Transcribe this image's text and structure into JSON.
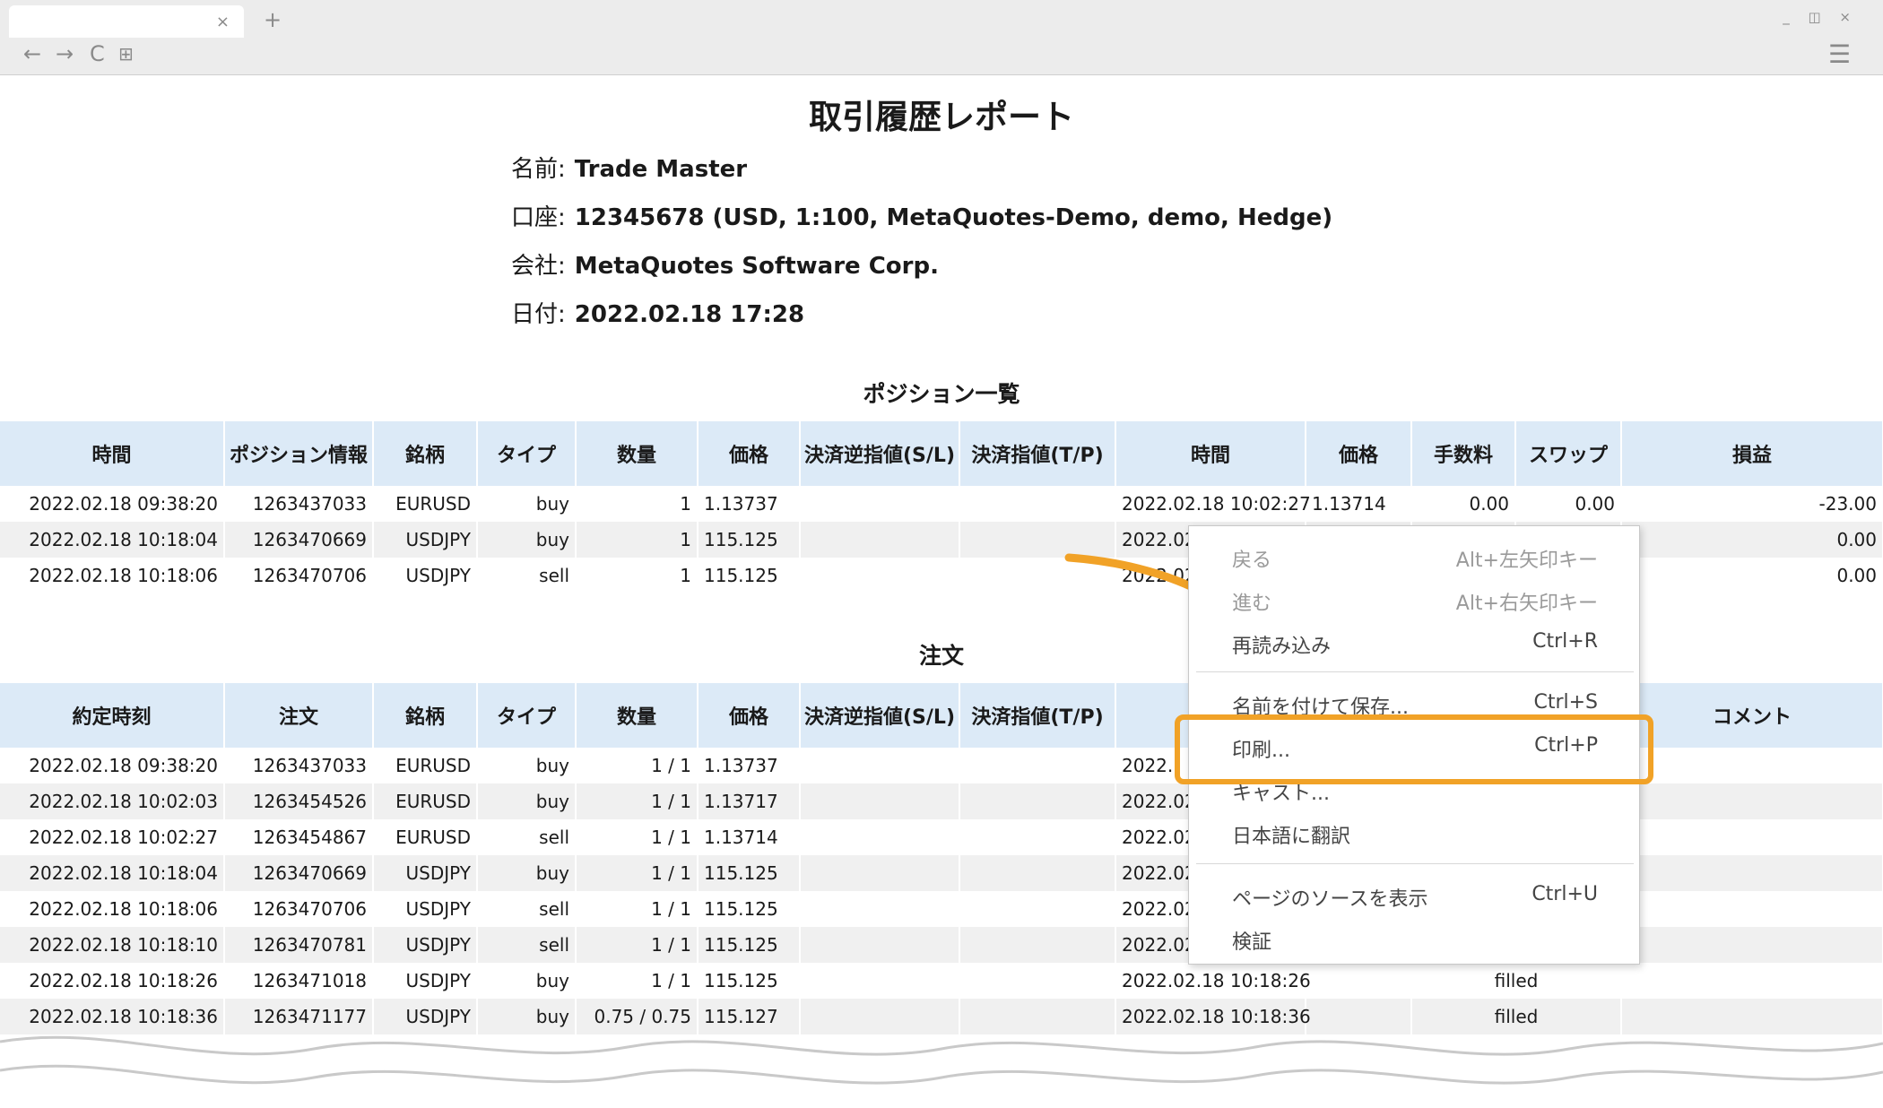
{
  "browser": {
    "tab_close": "×",
    "new_tab": "+",
    "window_controls": "_ ◫ ×",
    "nav": {
      "back": "←",
      "forward": "→",
      "reload": "C",
      "apps": "⊞",
      "menu": "☰"
    }
  },
  "report": {
    "title": "取引履歴レポート",
    "info": [
      {
        "label": "名前:",
        "value": "Trade Master"
      },
      {
        "label": "口座:",
        "value": "12345678 (USD, 1:100, MetaQuotes-Demo, demo, Hedge)"
      },
      {
        "label": "会社:",
        "value": "MetaQuotes Software Corp."
      },
      {
        "label": "日付:",
        "value": "2022.02.18 17:28"
      }
    ]
  },
  "positions": {
    "title": "ポジション一覧",
    "headers": [
      "時間",
      "ポジション情報",
      "銘柄",
      "タイプ",
      "数量",
      "価格",
      "決済逆指値(S/L)",
      "決済指値(T/P)",
      "時間",
      "価格",
      "手数料",
      "スワップ",
      "損益"
    ],
    "rows": [
      [
        "2022.02.18 09:38:20",
        "1263437033",
        "EURUSD",
        "buy",
        "1",
        "1.13737",
        "",
        "",
        "2022.02.18 10:02:27",
        "1.13714",
        "0.00",
        "0.00",
        "-23.00"
      ],
      [
        "2022.02.18 10:18:04",
        "1263470669",
        "USDJPY",
        "buy",
        "1",
        "115.125",
        "",
        "",
        "2022.02",
        "",
        "",
        "",
        "0.00"
      ],
      [
        "2022.02.18 10:18:06",
        "1263470706",
        "USDJPY",
        "sell",
        "1",
        "115.125",
        "",
        "",
        "2022.02",
        "",
        "",
        "",
        "0.00"
      ]
    ]
  },
  "orders": {
    "title": "注文",
    "headers": [
      "約定時刻",
      "注文",
      "銘柄",
      "タイプ",
      "数量",
      "価格",
      "決済逆指値(S/L)",
      "決済指値(T/P)",
      "",
      "",
      "",
      "コメント"
    ],
    "rows": [
      [
        "2022.02.18 09:38:20",
        "1263437033",
        "EURUSD",
        "buy",
        "1 / 1",
        "1.13737",
        "",
        "",
        "2022.",
        "",
        "",
        ""
      ],
      [
        "2022.02.18 10:02:03",
        "1263454526",
        "EURUSD",
        "buy",
        "1 / 1",
        "1.13717",
        "",
        "",
        "2022.02",
        "",
        "",
        ""
      ],
      [
        "2022.02.18 10:02:27",
        "1263454867",
        "EURUSD",
        "sell",
        "1 / 1",
        "1.13714",
        "",
        "",
        "2022.02",
        "",
        "",
        ""
      ],
      [
        "2022.02.18 10:18:04",
        "1263470669",
        "USDJPY",
        "buy",
        "1 / 1",
        "115.125",
        "",
        "",
        "2022.02",
        "",
        "",
        ""
      ],
      [
        "2022.02.18 10:18:06",
        "1263470706",
        "USDJPY",
        "sell",
        "1 / 1",
        "115.125",
        "",
        "",
        "2022.02",
        "",
        "",
        ""
      ],
      [
        "2022.02.18 10:18:10",
        "1263470781",
        "USDJPY",
        "sell",
        "1 / 1",
        "115.125",
        "",
        "",
        "2022.02",
        "",
        "",
        ""
      ],
      [
        "2022.02.18 10:18:26",
        "1263471018",
        "USDJPY",
        "buy",
        "1 / 1",
        "115.125",
        "",
        "",
        "2022.02.18 10:18:26",
        "",
        "filled",
        ""
      ],
      [
        "2022.02.18 10:18:36",
        "1263471177",
        "USDJPY",
        "buy",
        "0.75 / 0.75",
        "115.127",
        "",
        "",
        "2022.02.18 10:18:36",
        "",
        "filled",
        ""
      ]
    ]
  },
  "context_menu": {
    "items": [
      {
        "label": "戻る",
        "shortcut": "Alt+左矢印キー",
        "disabled": true
      },
      {
        "label": "進む",
        "shortcut": "Alt+右矢印キー",
        "disabled": true
      },
      {
        "label": "再読み込み",
        "shortcut": "Ctrl+R",
        "disabled": false
      },
      {
        "label": "名前を付けて保存...",
        "shortcut": "Ctrl+S",
        "disabled": false
      },
      {
        "label": "印刷...",
        "shortcut": "Ctrl+P",
        "disabled": false
      },
      {
        "label": "キャスト...",
        "shortcut": "",
        "disabled": false
      },
      {
        "label": "日本語に翻訳",
        "shortcut": "",
        "disabled": false
      },
      {
        "label": "ページのソースを表示",
        "shortcut": "Ctrl+U",
        "disabled": false
      },
      {
        "label": "検証",
        "shortcut": "",
        "disabled": false
      }
    ]
  },
  "accent_color": "#f1a227",
  "header_bg": "#dceaf7"
}
